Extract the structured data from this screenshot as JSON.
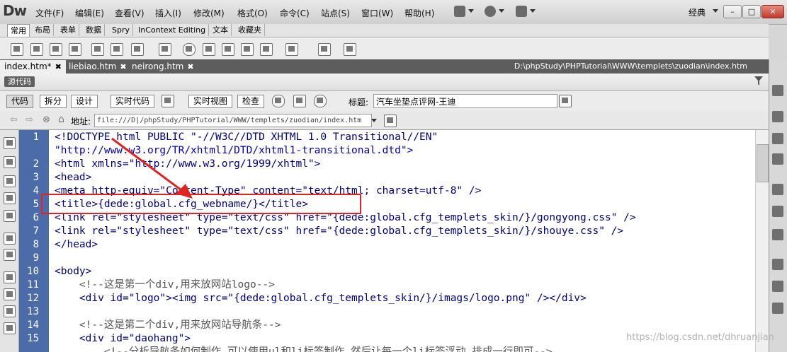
{
  "app": {
    "logo": "Dw"
  },
  "menu": [
    "文件(F)",
    "编辑(E)",
    "查看(V)",
    "插入(I)",
    "修改(M)",
    "格式(O)",
    "命令(C)",
    "站点(S)",
    "窗口(W)",
    "帮助(H)"
  ],
  "workspace": {
    "label": "经典"
  },
  "insert_tabs": [
    "常用",
    "布局",
    "表单",
    "数据",
    "Spry",
    "InContext Editing",
    "文本",
    "收藏夹"
  ],
  "doc_tabs": [
    {
      "label": "index.htm*",
      "active": true
    },
    {
      "label": "liebiao.htm",
      "active": false
    },
    {
      "label": "neirong.htm",
      "active": false
    }
  ],
  "doc_path": "D:\\phpStudy\\PHPTutorial\\WWW\\templets\\zuodian\\index.htm",
  "source_label": "源代码",
  "view_buttons": [
    "代码",
    "拆分",
    "设计",
    "实时代码",
    "实时视图",
    "检查"
  ],
  "title_field": {
    "label": "标题:",
    "value": "汽车坐垫点评网-王迪"
  },
  "address": {
    "label": "地址:",
    "value": "file:///D|/phpStudy/PHPTutorial/WWW/templets/zuodian/index.htm"
  },
  "code_lines": [
    {
      "n": "1",
      "text": "<!DOCTYPE html PUBLIC \"-//W3C//DTD XHTML 1.0 Transitional//EN\""
    },
    {
      "n": "",
      "text": "\"http://www.w3.org/TR/xhtml1/DTD/xhtml1-transitional.dtd\">"
    },
    {
      "n": "2",
      "text": "<html xmlns=\"http://www.w3.org/1999/xhtml\">"
    },
    {
      "n": "3",
      "text": "<head>"
    },
    {
      "n": "4",
      "text": "<meta http-equiv=\"Content-Type\" content=\"text/html; charset=utf-8\" />"
    },
    {
      "n": "5",
      "text": "<title>{dede:global.cfg_webname/}</title>"
    },
    {
      "n": "6",
      "text": "<link rel=\"stylesheet\" type=\"text/css\" href=\"{dede:global.cfg_templets_skin/}/gongyong.css\" />"
    },
    {
      "n": "7",
      "text": "<link rel=\"stylesheet\" type=\"text/css\" href=\"{dede:global.cfg_templets_skin/}/shouye.css\" />"
    },
    {
      "n": "8",
      "text": "</head>"
    },
    {
      "n": "9",
      "text": ""
    },
    {
      "n": "10",
      "text": "<body>"
    },
    {
      "n": "11",
      "text": "    <!--这是第一个div,用来放网站logo-->"
    },
    {
      "n": "12",
      "text": "    <div id=\"logo\"><img src=\"{dede:global.cfg_templets_skin/}/imags/logo.png\" /></div>"
    },
    {
      "n": "13",
      "text": ""
    },
    {
      "n": "14",
      "text": "    <!--这是第二个div,用来放网站导航条-->"
    },
    {
      "n": "15",
      "text": "    <div id=\"daohang\">"
    },
    {
      "n": "",
      "text": "        <!--分析导航条如何制作,可以使用ul和li标签制作,然后让每一个li标签浮动,排成一行即可-->"
    }
  ],
  "watermark": "https://blog.csdn.net/dhruanjian",
  "colors": {
    "gutter": "#4b6ca8",
    "highlight": "#e02222",
    "arrow": "#e02222"
  }
}
